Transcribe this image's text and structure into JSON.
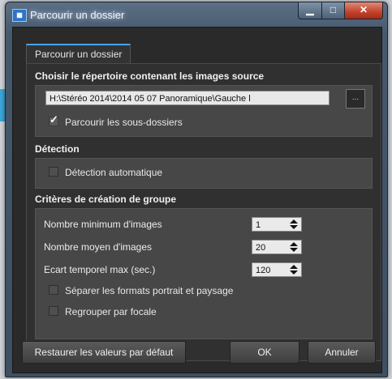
{
  "window": {
    "title": "Parcourir un dossier"
  },
  "tab": {
    "label": "Parcourir un dossier"
  },
  "source": {
    "heading": "Choisir le répertoire contenant les images source",
    "path_value": "H:\\Stéréo 2014\\2014 05 07 Panoramique\\Gauche l",
    "browse_label": "...",
    "subfolders_label": "Parcourir les sous-dossiers",
    "subfolders_checked": true
  },
  "detection": {
    "heading": "Détection",
    "auto_label": "Détection automatique",
    "auto_checked": false
  },
  "group": {
    "heading": "Critères de création de groupe",
    "min_images_label": "Nombre minimum d'images",
    "min_images_value": "1",
    "avg_images_label": "Nombre moyen d'images",
    "avg_images_value": "20",
    "time_gap_label": "Ecart temporel max (sec.)",
    "time_gap_value": "120",
    "separate_label": "Séparer les formats portrait et paysage",
    "separate_checked": false,
    "focal_label": "Regrouper par focale",
    "focal_checked": false
  },
  "buttons": {
    "restore": "Restaurer les valeurs par défaut",
    "ok": "OK",
    "cancel": "Annuler"
  }
}
